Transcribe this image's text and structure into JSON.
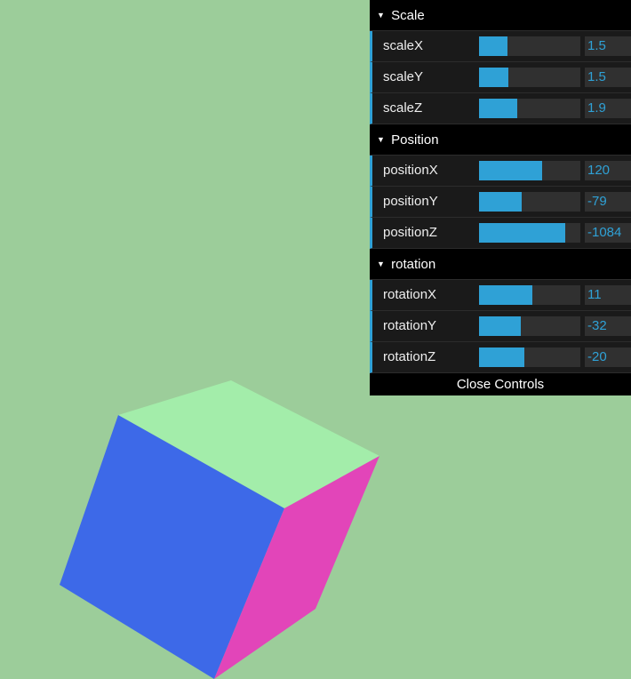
{
  "colors": {
    "background": "#9ccd9a",
    "cube_top": "#a3edaa",
    "cube_front": "#3d69e8",
    "cube_side": "#e245b9",
    "accent": "#2fa1d6"
  },
  "gui": {
    "folders": [
      {
        "title": "Scale",
        "rows": [
          {
            "name": "scaleX",
            "value": "1.5",
            "fill": 0.28
          },
          {
            "name": "scaleY",
            "value": "1.5",
            "fill": 0.29
          },
          {
            "name": "scaleZ",
            "value": "1.9",
            "fill": 0.38
          }
        ]
      },
      {
        "title": "Position",
        "rows": [
          {
            "name": "positionX",
            "value": "120",
            "fill": 0.62
          },
          {
            "name": "positionY",
            "value": "-79",
            "fill": 0.42
          },
          {
            "name": "positionZ",
            "value": "-1084",
            "fill": 0.85
          }
        ]
      },
      {
        "title": "rotation",
        "rows": [
          {
            "name": "rotationX",
            "value": "11",
            "fill": 0.53
          },
          {
            "name": "rotationY",
            "value": "-32",
            "fill": 0.41
          },
          {
            "name": "rotationZ",
            "value": "-20",
            "fill": 0.45
          }
        ]
      }
    ],
    "close_label": "Close Controls"
  }
}
